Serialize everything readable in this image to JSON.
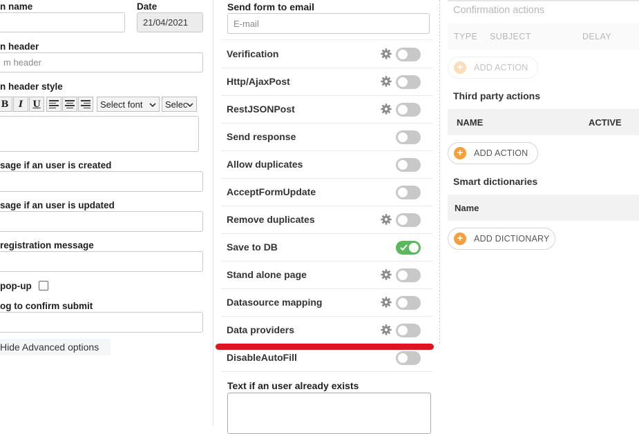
{
  "left": {
    "form_name_label": "n name",
    "date_label": "Date",
    "date_value": "21/04/2021",
    "form_header_label": "n header",
    "form_header_placeholder": "m header",
    "form_header_style_label": "n header style",
    "toolbar": {
      "bold": "B",
      "italic": "I",
      "underline": "U",
      "font_select": "Select font",
      "size_select": "Selec"
    },
    "created_msg_label": "sage if an user is created",
    "updated_msg_label": "sage if an user is updated",
    "registration_msg_label": "registration message",
    "popup_label": "pop-up",
    "confirm_submit_label": "og to confirm submit",
    "advanced_toggle": "Hide Advanced options"
  },
  "middle": {
    "send_form_label": "Send form to email",
    "email_placeholder": "E-mail",
    "rows": [
      {
        "label": "Verification",
        "gear": true,
        "on": false
      },
      {
        "label": "Http/AjaxPost",
        "gear": true,
        "on": false
      },
      {
        "label": "RestJSONPost",
        "gear": true,
        "on": false
      },
      {
        "label": "Send response",
        "gear": false,
        "on": false
      },
      {
        "label": "Allow duplicates",
        "gear": false,
        "on": false
      },
      {
        "label": "AcceptFormUpdate",
        "gear": false,
        "on": false
      },
      {
        "label": "Remove duplicates",
        "gear": true,
        "on": false
      },
      {
        "label": "Save to DB",
        "gear": false,
        "on": true
      },
      {
        "label": "Stand alone page",
        "gear": true,
        "on": false
      },
      {
        "label": "Datasource mapping",
        "gear": true,
        "on": false
      },
      {
        "label": "Data providers",
        "gear": true,
        "on": false
      },
      {
        "label": "DisableAutoFill",
        "gear": false,
        "on": false
      }
    ],
    "user_exists_label": "Text if an user already exists"
  },
  "right": {
    "confirmation_title": "Confirmation actions",
    "conf_cols": {
      "type": "TYPE",
      "subject": "SUBJECT",
      "delay": "DELAY"
    },
    "conf_add": "ADD ACTION",
    "third_party_title": "Third party actions",
    "tp_cols": {
      "name": "NAME",
      "active": "ACTIVE"
    },
    "tp_add": "ADD ACTION",
    "dict_title": "Smart dictionaries",
    "dict_col": "Name",
    "dict_add": "ADD DICTIONARY"
  },
  "colors": {
    "accent_orange": "#f5a03a",
    "toggle_on": "#5cb85c",
    "toggle_off": "#c8c8c8",
    "annotation_red": "#e0141e"
  },
  "icons": {
    "settings": "gear-icon",
    "add": "plus-circle-icon",
    "checked": "check-icon"
  }
}
